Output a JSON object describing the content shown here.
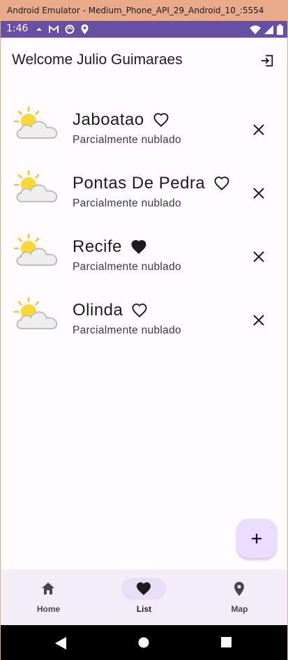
{
  "window": {
    "title": "Android Emulator - Medium_Phone_API_29_Android_10_:5554"
  },
  "statusbar": {
    "time": "1:46",
    "icons": [
      "notification-icon",
      "gmail-icon",
      "sync-icon",
      "location-icon",
      "wifi-icon",
      "signal-icon",
      "battery-icon"
    ]
  },
  "appbar": {
    "title": "Welcome Julio Guimaraes",
    "action_icon": "logout-icon"
  },
  "cities": [
    {
      "name": "Jaboatao",
      "description": "Parcialmente nublado",
      "favorite": false,
      "icon": "partly-cloudy-icon"
    },
    {
      "name": "Pontas De Pedra",
      "description": "Parcialmente nublado",
      "favorite": false,
      "icon": "partly-cloudy-icon"
    },
    {
      "name": "Recife",
      "description": "Parcialmente nublado",
      "favorite": true,
      "icon": "partly-cloudy-icon"
    },
    {
      "name": "Olinda",
      "description": "Parcialmente nublado",
      "favorite": false,
      "icon": "partly-cloudy-icon"
    }
  ],
  "fab": {
    "icon": "add-icon"
  },
  "navbar": {
    "items": [
      {
        "label": "Home",
        "icon": "home-icon",
        "active": false
      },
      {
        "label": "List",
        "icon": "heart-icon",
        "active": true
      },
      {
        "label": "Map",
        "icon": "map-pin-icon",
        "active": false
      }
    ]
  },
  "colors": {
    "status_bar": "#6750a4",
    "background": "#fffbff",
    "fab": "#eaddff",
    "navbar": "#f3edf7",
    "nav_indicator": "#e8def8",
    "sun": "#fbc02d",
    "cloud": "#eeeeee"
  }
}
